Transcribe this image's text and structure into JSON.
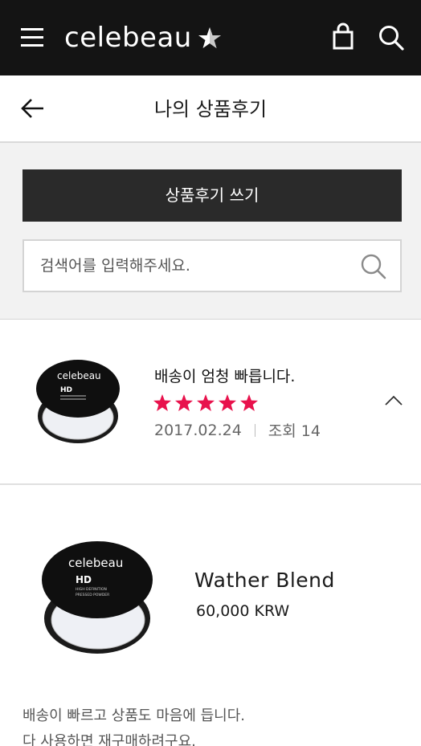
{
  "header": {
    "logo_text": "celebeau",
    "icons": [
      "menu-icon",
      "star-logo-icon",
      "shopping-bag-icon",
      "search-icon"
    ],
    "background": "#141414"
  },
  "titlebar": {
    "title": "나의 상품후기",
    "back_icon": "arrow-left-icon"
  },
  "actions": {
    "write_label": "상품후기 쓰기",
    "search_placeholder": "검색어를 입력해주세요.",
    "search_value": ""
  },
  "review": {
    "title": "배송이 엄청 빠릅니다.",
    "rating": 5,
    "rating_max": 5,
    "star_color": "#e8124c",
    "date": "2017.02.24",
    "views_label": "조회 14",
    "expanded": true,
    "thumb_brand": "celebeau",
    "thumb_label": "HD"
  },
  "product": {
    "name": "Wather Blend",
    "price": "60,000  KRW",
    "brand": "celebeau",
    "label": "HD",
    "sublabel_1": "HIGH DEFINITION",
    "sublabel_2": "PRESSED POWDER"
  },
  "review_body": {
    "line1": "배송이 빠르고 상품도 마음에 듭니다.",
    "line2": "다 사용하면 재구매하려구요."
  }
}
